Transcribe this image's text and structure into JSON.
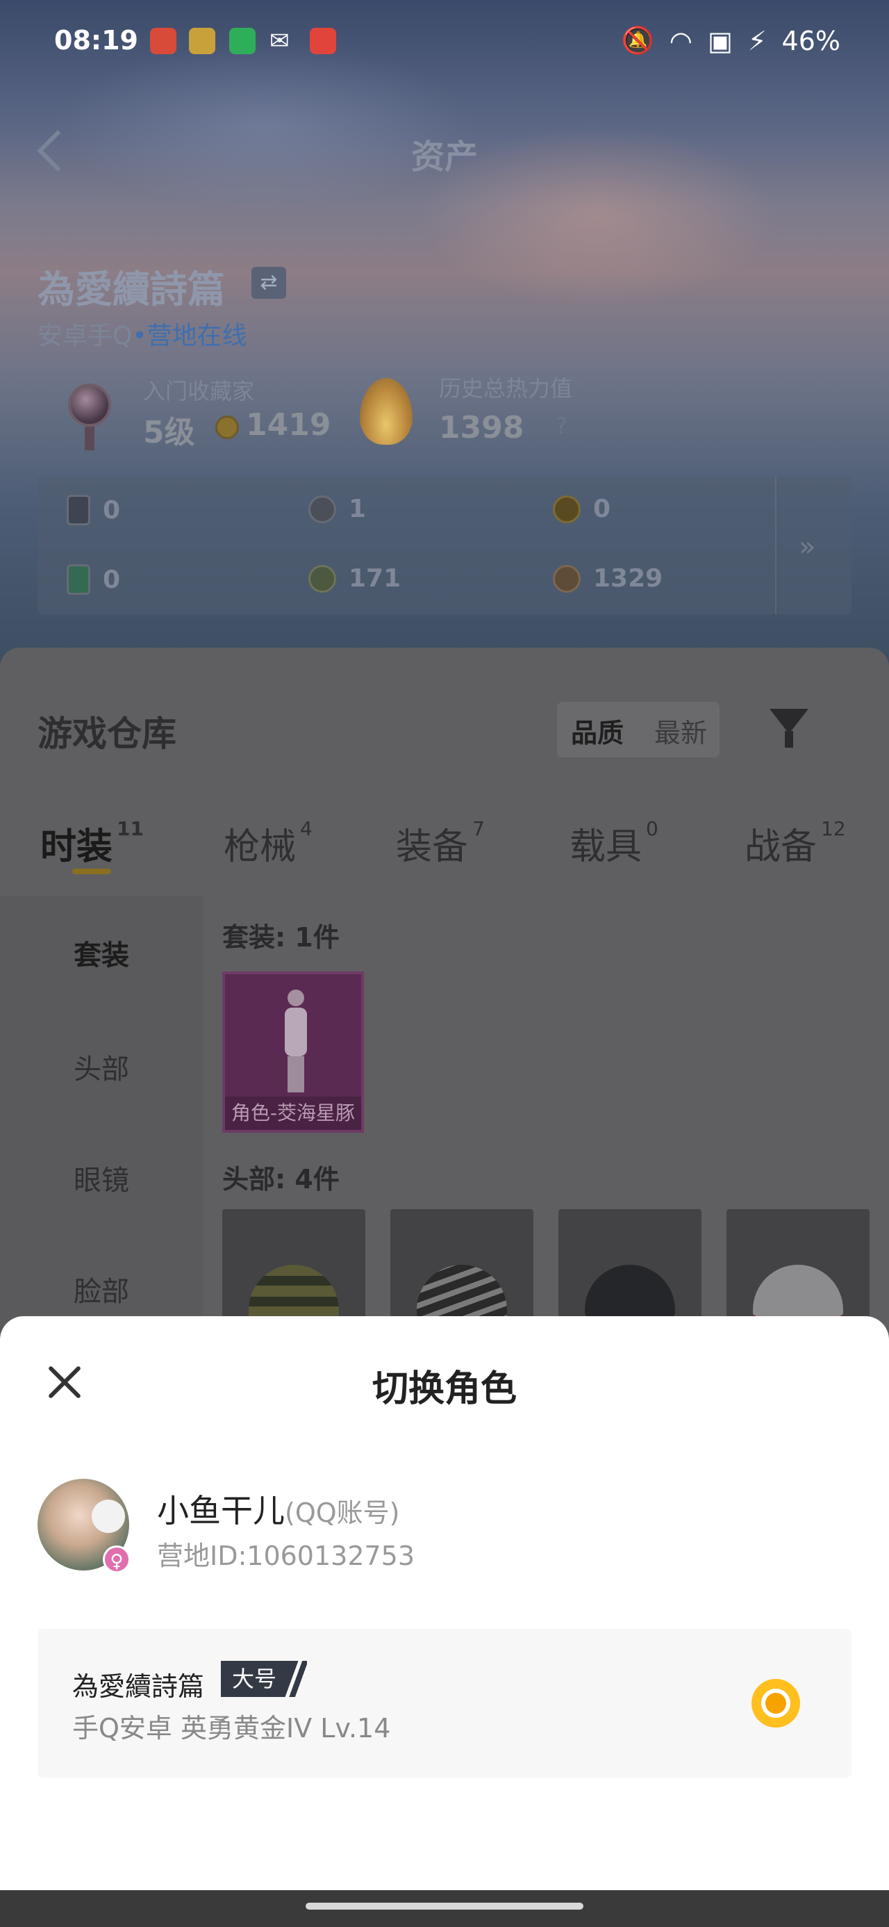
{
  "status_bar": {
    "time": "08:19",
    "battery": "46%",
    "icons": [
      "app-notification-1-icon",
      "app-notification-2-icon",
      "shield-app-icon",
      "wechat-icon",
      "video-app-icon",
      "mute-icon",
      "wifi-icon",
      "sim-icon",
      "charging-icon"
    ]
  },
  "header": {
    "title": "资产"
  },
  "player": {
    "name": "為愛續詩篇",
    "swap_symbol": "⇄",
    "platform": "安卓手Q",
    "status_dot": "•",
    "status": "营地在线"
  },
  "stats": {
    "collector_label": "入门收藏家",
    "collector_level": "5级",
    "collector_points": "1419",
    "heat_label": "历史总热力值",
    "heat_value": "1398",
    "heat_help": "?"
  },
  "resources": [
    {
      "icon": "card-icon",
      "value": "0"
    },
    {
      "icon": "token-icon",
      "value": "1"
    },
    {
      "icon": "gold-coin-icon",
      "value": "0"
    },
    {
      "icon": "green-card-icon",
      "value": "0"
    },
    {
      "icon": "olive-coin-icon",
      "value": "171"
    },
    {
      "icon": "bronze-coin-icon",
      "value": "1329"
    }
  ],
  "resources_more": "»",
  "warehouse": {
    "title": "游戏仓库",
    "sort_quality": "品质",
    "sort_new": "最新",
    "tabs": [
      {
        "label": "时装",
        "count": "11"
      },
      {
        "label": "枪械",
        "count": "4"
      },
      {
        "label": "装备",
        "count": "7"
      },
      {
        "label": "载具",
        "count": "0"
      },
      {
        "label": "战备",
        "count": "12"
      }
    ],
    "side": [
      "套装",
      "头部",
      "眼镜",
      "脸部"
    ],
    "group_suit": "套装: 1件",
    "suit_item": "角色-茭海星豚",
    "group_head": "头部: 4件"
  },
  "sheet": {
    "title": "切换角色",
    "account_name": "小鱼干儿",
    "account_type": "(QQ账号)",
    "account_id": "营地ID:1060132753",
    "gender_symbol": "♀",
    "role_name": "為愛續詩篇",
    "role_tag": "大号",
    "role_detail": "手Q安卓  英勇黄金IV  Lv.14"
  },
  "colors": {
    "accent": "#f6a300",
    "tag_bg": "#333a45",
    "online": "#3f6fae"
  }
}
